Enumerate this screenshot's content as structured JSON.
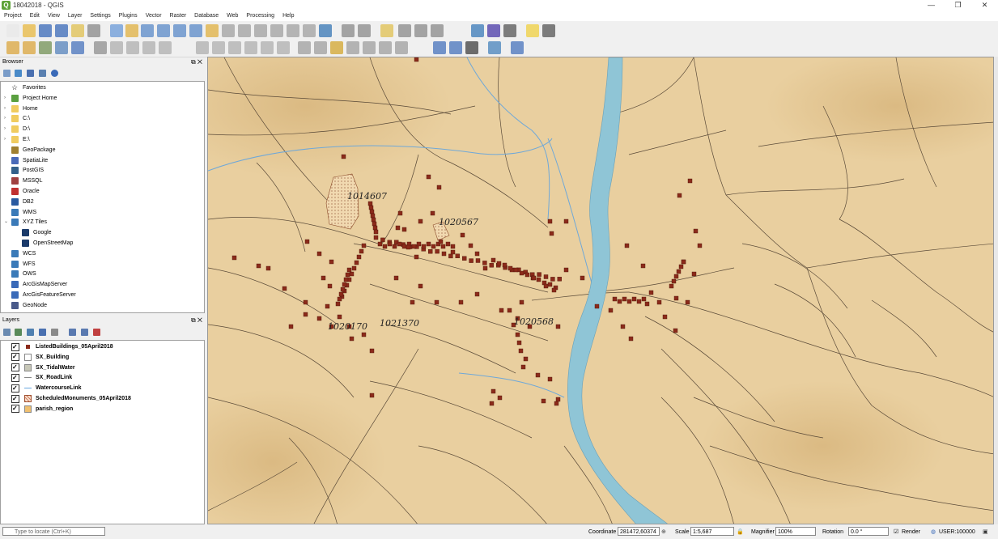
{
  "window": {
    "title": "18042018 - QGIS",
    "buttons": [
      "—",
      "❐",
      "✕"
    ]
  },
  "menu": [
    "Project",
    "Edit",
    "View",
    "Layer",
    "Settings",
    "Plugins",
    "Vector",
    "Raster",
    "Database",
    "Web",
    "Processing",
    "Help"
  ],
  "browser": {
    "title": "Browser",
    "items": [
      {
        "label": "Favorites",
        "icon": "star-icon",
        "expand": false,
        "indent": 0
      },
      {
        "label": "Project Home",
        "icon": "project-home-icon",
        "expand": true,
        "indent": 0
      },
      {
        "label": "Home",
        "icon": "folder-icon",
        "expand": true,
        "indent": 0
      },
      {
        "label": "C:\\",
        "icon": "folder-icon",
        "expand": true,
        "indent": 0
      },
      {
        "label": "D:\\",
        "icon": "folder-icon",
        "expand": true,
        "indent": 0
      },
      {
        "label": "E:\\",
        "icon": "folder-icon",
        "expand": true,
        "indent": 0
      },
      {
        "label": "GeoPackage",
        "icon": "geopackage-icon",
        "expand": false,
        "indent": 0
      },
      {
        "label": "SpatiaLite",
        "icon": "spatialite-icon",
        "expand": false,
        "indent": 0
      },
      {
        "label": "PostGIS",
        "icon": "postgis-icon",
        "expand": false,
        "indent": 0
      },
      {
        "label": "MSSQL",
        "icon": "mssql-icon",
        "expand": false,
        "indent": 0
      },
      {
        "label": "Oracle",
        "icon": "oracle-icon",
        "expand": false,
        "indent": 0
      },
      {
        "label": "DB2",
        "icon": "db2-icon",
        "expand": false,
        "indent": 0
      },
      {
        "label": "WMS",
        "icon": "wms-icon",
        "expand": false,
        "indent": 0
      },
      {
        "label": "XYZ Tiles",
        "icon": "xyz-tiles-icon",
        "expand": true,
        "indent": 0
      },
      {
        "label": "Google",
        "icon": "tile-grid-icon",
        "expand": false,
        "indent": 1
      },
      {
        "label": "OpenStreetMap",
        "icon": "tile-grid-icon",
        "expand": false,
        "indent": 1
      },
      {
        "label": "WCS",
        "icon": "wcs-icon",
        "expand": false,
        "indent": 0
      },
      {
        "label": "WFS",
        "icon": "wfs-icon",
        "expand": false,
        "indent": 0
      },
      {
        "label": "OWS",
        "icon": "ows-icon",
        "expand": false,
        "indent": 0
      },
      {
        "label": "ArcGisMapServer",
        "icon": "arcgis-map-icon",
        "expand": false,
        "indent": 0
      },
      {
        "label": "ArcGisFeatureServer",
        "icon": "arcgis-feature-icon",
        "expand": false,
        "indent": 0
      },
      {
        "label": "GeoNode",
        "icon": "geonode-icon",
        "expand": false,
        "indent": 0
      }
    ]
  },
  "layers": {
    "title": "Layers",
    "items": [
      {
        "label": "ListedBuildings_05April2018",
        "swatch": "point",
        "color": "#8b2a1a"
      },
      {
        "label": "SX_Building",
        "swatch": "fill",
        "color": "#ffffff"
      },
      {
        "label": "SX_TidalWater",
        "swatch": "fill",
        "color": "#c8c8b8"
      },
      {
        "label": "SX_RoadLink",
        "swatch": "line",
        "color": "#888888"
      },
      {
        "label": "WatercourseLink",
        "swatch": "line",
        "color": "#6aa8e0"
      },
      {
        "label": "ScheduledMonuments_05April2018",
        "swatch": "hatch",
        "color": "#d08060"
      },
      {
        "label": "parish_region",
        "swatch": "fill",
        "color": "#f0c070"
      }
    ]
  },
  "map": {
    "labels": [
      "1014607",
      "1020567",
      "1020170",
      "1021370",
      "1020568"
    ],
    "colors": {
      "paper": "#e9cf9f",
      "river": "#8fc5d6",
      "building": "#8b2a1a",
      "road": "#5a4a38",
      "stream": "#6fa8d8"
    }
  },
  "status": {
    "locate_placeholder": "Type to locate (Ctrl+K)",
    "coordinate_label": "Coordinate",
    "coordinate_value": "281472,60374",
    "scale_label": "Scale",
    "scale_value": "1:5,687",
    "magnifier_label": "Magnifier",
    "magnifier_value": "100%",
    "rotation_label": "Rotation",
    "rotation_value": "0.0 °",
    "render_label": "Render",
    "crs_value": "USER:100000"
  }
}
